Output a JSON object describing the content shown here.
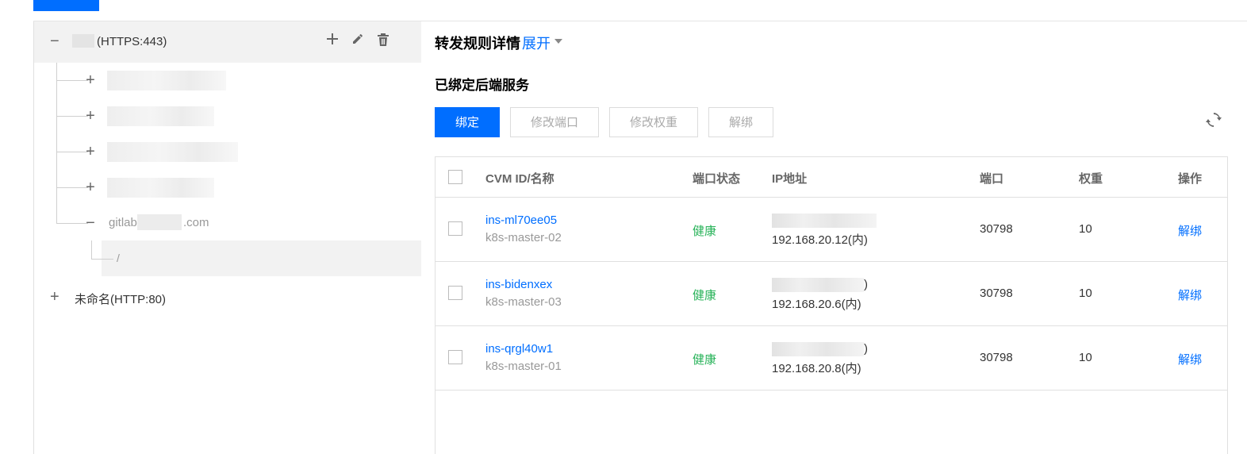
{
  "left": {
    "listener": {
      "label": "(HTTPS:443)",
      "collapse_symbol": "−",
      "add_icon": "plus-icon",
      "edit_icon": "pencil-icon",
      "delete_icon": "trash-icon"
    },
    "domains": [
      {
        "toggle": "+"
      },
      {
        "toggle": "+"
      },
      {
        "toggle": "+"
      },
      {
        "toggle": "+"
      },
      {
        "toggle": "−",
        "label_prefix": "gitlab.",
        "label_suffix": ".com"
      }
    ],
    "path": {
      "label": "/"
    },
    "unnamed_listener": {
      "toggle": "+",
      "label": "未命名(HTTP:80)"
    }
  },
  "right": {
    "title": "转发规则详情",
    "expand_label": "展开",
    "bound_title": "已绑定后端服务",
    "buttons": {
      "bind": "绑定",
      "modify_port": "修改端口",
      "modify_weight": "修改权重",
      "unbind": "解绑"
    },
    "table": {
      "headers": [
        "CVM ID/名称",
        "端口状态",
        "IP地址",
        "端口",
        "权重",
        "操作"
      ],
      "rows": [
        {
          "id": "ins-ml70ee05",
          "name": "k8s-master-02",
          "status": "健康",
          "ip_public_suffix": "",
          "ip_private": "192.168.20.12(内)",
          "port": "30798",
          "weight": "10",
          "action": "解绑"
        },
        {
          "id": "ins-bidenxex",
          "name": "k8s-master-03",
          "status": "健康",
          "ip_public_suffix": ")",
          "ip_private": "192.168.20.6(内)",
          "port": "30798",
          "weight": "10",
          "action": "解绑"
        },
        {
          "id": "ins-qrgl40w1",
          "name": "k8s-master-01",
          "status": "健康",
          "ip_public_suffix": ")",
          "ip_private": "192.168.20.8(内)",
          "port": "30798",
          "weight": "10",
          "action": "解绑"
        }
      ]
    }
  },
  "colors": {
    "primary": "#006eff",
    "healthy": "#29b35a",
    "border": "#e0e0e0",
    "row_highlight": "#f2f2f2"
  }
}
